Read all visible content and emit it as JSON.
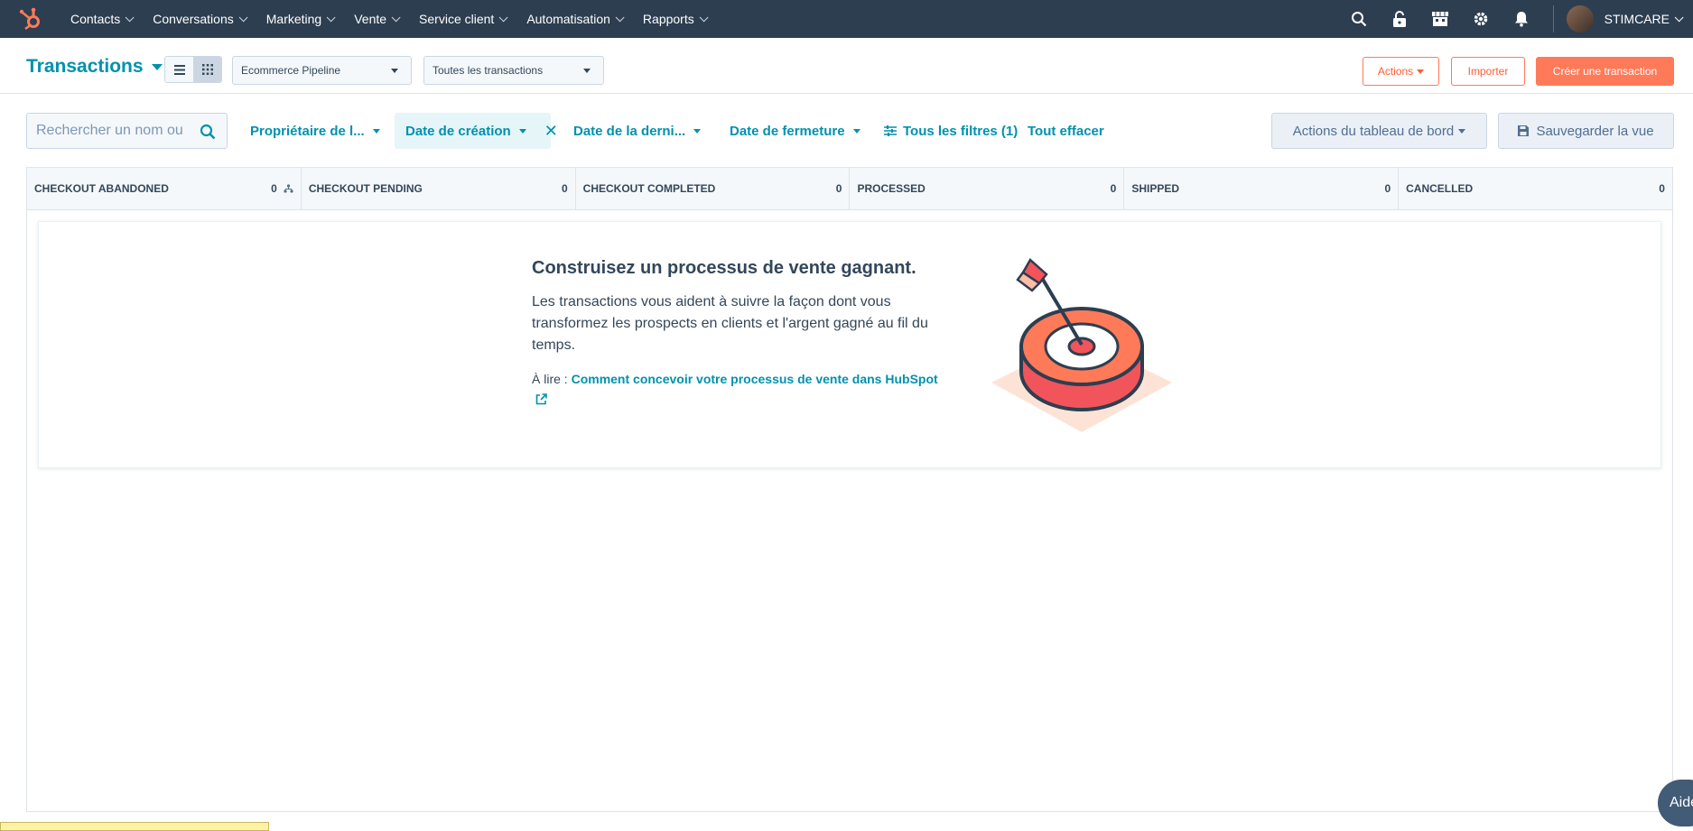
{
  "nav": {
    "items": [
      "Contacts",
      "Conversations",
      "Marketing",
      "Vente",
      "Service client",
      "Automatisation",
      "Rapports"
    ],
    "account_name": "STIMCARE",
    "icons": [
      "search-icon",
      "unlock-icon",
      "marketplace-icon",
      "settings-icon",
      "notifications-icon"
    ]
  },
  "header": {
    "title": "Transactions",
    "pipeline_select": "Ecommerce Pipeline",
    "view_select": "Toutes les transactions",
    "actions_label": "Actions",
    "import_label": "Importer",
    "create_label": "Créer une transaction"
  },
  "filters": {
    "search_placeholder": "Rechercher un nom ou",
    "owner": "Propriétaire de l...",
    "created_date": "Date de création",
    "last_activity": "Date de la derni...",
    "close_date": "Date de fermeture",
    "all_filters": "Tous les filtres (1)",
    "clear_all": "Tout effacer",
    "board_actions": "Actions du tableau de bord",
    "save_view": "Sauvegarder la vue"
  },
  "stages": [
    {
      "name": "CHECKOUT ABANDONED",
      "count": "0"
    },
    {
      "name": "CHECKOUT PENDING",
      "count": "0"
    },
    {
      "name": "CHECKOUT COMPLETED",
      "count": "0"
    },
    {
      "name": "PROCESSED",
      "count": "0"
    },
    {
      "name": "SHIPPED",
      "count": "0"
    },
    {
      "name": "CANCELLED",
      "count": "0"
    }
  ],
  "empty_state": {
    "title": "Construisez un processus de vente gagnant.",
    "description": "Les transactions vous aident à suivre la façon dont vous transformez les prospects en clients et l'argent gagné au fil du temps.",
    "read_prefix": "À lire : ",
    "read_link": "Comment concevoir votre processus de vente dans HubSpot"
  },
  "help_label": "Aide",
  "colors": {
    "nav_bg": "#2d3e50",
    "accent": "#0091ae",
    "brand": "#ff7a59"
  }
}
